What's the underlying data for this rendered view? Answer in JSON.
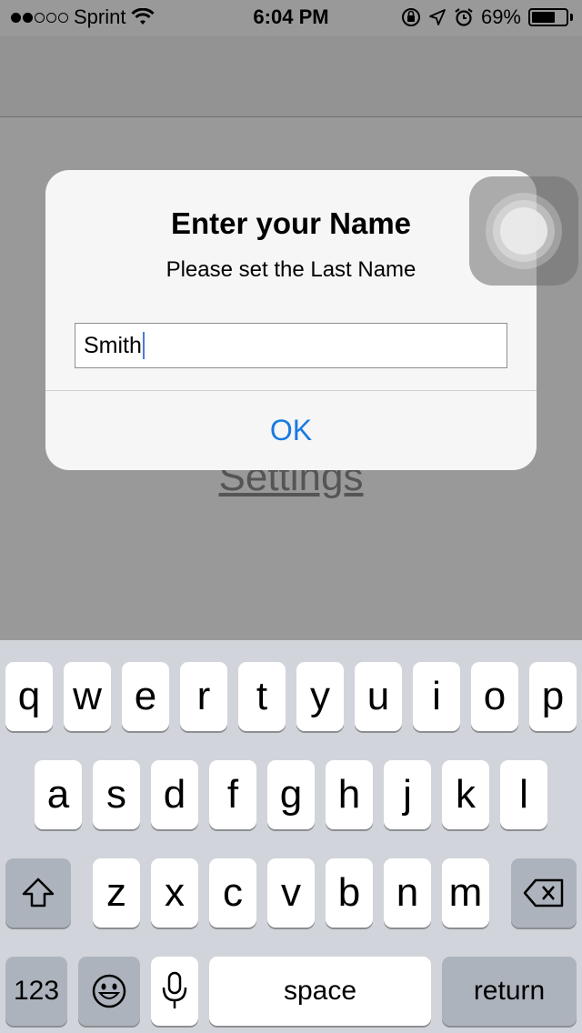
{
  "status_bar": {
    "carrier": "Sprint",
    "time": "6:04 PM",
    "battery": "69%",
    "battery_level": 0.69,
    "signal_bars_filled": 2,
    "signal_bars_total": 5
  },
  "background": {
    "settings_link": "Settings"
  },
  "alert": {
    "title": "Enter your Name",
    "message": "Please set the Last Name",
    "field_value": "Smith",
    "ok_label": "OK"
  },
  "keyboard": {
    "row1": [
      "q",
      "w",
      "e",
      "r",
      "t",
      "y",
      "u",
      "i",
      "o",
      "p"
    ],
    "row2": [
      "a",
      "s",
      "d",
      "f",
      "g",
      "h",
      "j",
      "k",
      "l"
    ],
    "row3": [
      "z",
      "x",
      "c",
      "v",
      "b",
      "n",
      "m"
    ],
    "numbers_label": "123",
    "space_label": "space",
    "return_label": "return",
    "icons": {
      "shift": "shift-icon",
      "delete": "delete-icon",
      "emoji": "emoji-icon",
      "mic": "microphone-icon"
    }
  },
  "colors": {
    "accent": "#1a7ae0",
    "dim_background": "#999999",
    "keyboard_background": "#d1d4da"
  }
}
